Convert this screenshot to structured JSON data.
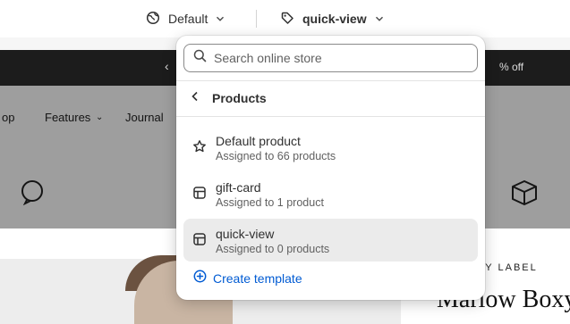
{
  "toolbar": {
    "theme_label": "Default",
    "template_label": "quick-view"
  },
  "store_preview": {
    "announcement": "% off",
    "nav_items": [
      "op",
      "Features",
      "Journal"
    ],
    "hero_label": "LY LABEL",
    "hero_title": "Marlow Boxy"
  },
  "popover": {
    "search_placeholder": "Search online store",
    "section_title": "Products",
    "templates": [
      {
        "name": "Default product",
        "detail": "Assigned to 66 products",
        "icon": "star-icon",
        "selected": false
      },
      {
        "name": "gift-card",
        "detail": "Assigned to 1 product",
        "icon": "template-icon",
        "selected": false
      },
      {
        "name": "quick-view",
        "detail": "Assigned to 0 products",
        "icon": "template-icon",
        "selected": true
      }
    ],
    "create_label": "Create template"
  },
  "colors": {
    "accent": "#005bd3",
    "selected_bg": "#ebebeb",
    "text": "#303030",
    "subtext": "#616161"
  }
}
